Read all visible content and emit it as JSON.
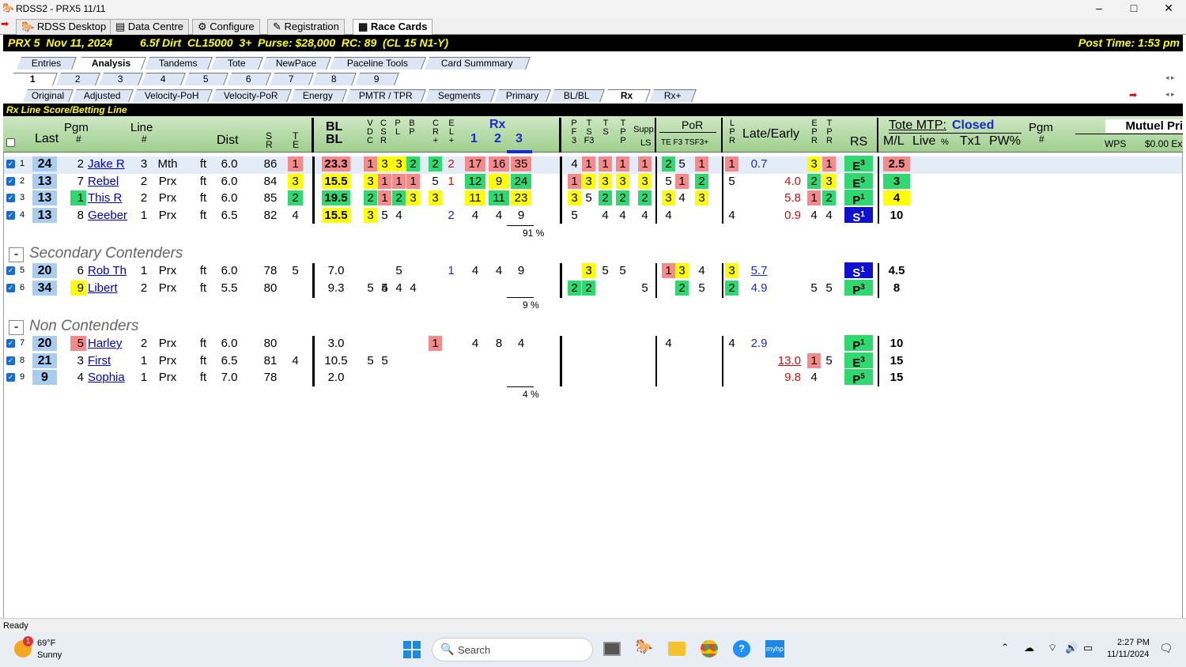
{
  "window": {
    "title": "RDSS2 - PRX5  11/11",
    "minimize": "–",
    "maximize": "□",
    "close": "✕"
  },
  "app_tabs": [
    "RDSS Desktop",
    "Data Centre",
    "Configure",
    "Registration",
    "Race Cards"
  ],
  "race": {
    "info": "PRX 5  Nov 11, 2024         6.5f Dirt  CL15000  3+  Purse: $28,000  RC: 89  (CL 15 N1-Y)",
    "post": "Post Time: 1:53 pm"
  },
  "view_tabs": [
    "Entries",
    "Analysis",
    "Tandems",
    "Tote",
    "NewPace",
    "Paceline Tools",
    "Card Summmary"
  ],
  "race_tabs": [
    "1",
    "2",
    "3",
    "4",
    "5",
    "6",
    "7",
    "8",
    "9"
  ],
  "sub_tabs": [
    "Original",
    "Adjusted",
    "Velocity-PoH",
    "Velocity-PoR",
    "Energy",
    "PMTR / TPR",
    "Segments",
    "Primary",
    "BL/BL",
    "Rx",
    "Rx+"
  ],
  "section_label": "Rx Line Score/Betting Line",
  "header": {
    "last": "Last",
    "pgm": "Pgm",
    "pgm_hash": "#",
    "line": "Line",
    "line_hash": "#",
    "dist": "Dist",
    "sr": "S\nR",
    "te": "T\nE",
    "blbl": "BL\nBL",
    "vdc": "V\nD\nC",
    "csr": "C\nS\nR",
    "pl": "P\nL",
    "bp": "B\nP",
    "cr": "C\nR\n+",
    "el": "E\nL\n+",
    "rx": "Rx",
    "rx1": "1",
    "rx2": "2",
    "rx3": "3",
    "pf3": "P\nF\n3",
    "tsf3": "T\nS\nF3",
    "ts": "T\nS",
    "tp": "T\nP\nP",
    "supp": "Supp.",
    "ls": "LS",
    "por": "PoR",
    "por_sub": "TE F3 TSF3+",
    "lpr": "L\nP\nR",
    "late": "Late/Early",
    "epr": "E\nP\nR",
    "tpr": "T\nP\nR",
    "rs": "RS",
    "tote": "Tote MTP:",
    "closed": "Closed",
    "ml": "M/L",
    "live": "Live",
    "pct": "%",
    "tx1": "Tx1",
    "pw": "PW%",
    "pgm2": "Pgm",
    "pgm2h": "#",
    "mutuel": "Mutuel Pri",
    "wps": "WPS",
    "ex": "$0.00 Ex"
  },
  "rows": [
    {
      "n": "1",
      "last": "24",
      "pgm": "2",
      "name": "Jake R",
      "line": "3",
      "trk": "Mth",
      "sf": "ft",
      "dist": "6.0",
      "sr": "86",
      "te": "1",
      "bl": "23.3",
      "vdc": "1",
      "csr": "3",
      "pl": "3",
      "bp": "2",
      "cr": "2",
      "el": "2",
      "r1": "17",
      "r2": "16",
      "r3": "35",
      "pf3": "4",
      "tsf3": "1",
      "ts": "1",
      "tp": "1",
      "supp": "1",
      "te2": "2",
      "f3": "5",
      "tsf": "1",
      "lpr": "1",
      "late": "0.7",
      "early": "",
      "epr": "3",
      "tpr": "1",
      "rs": "E",
      "rsn": "3",
      "ml": "2.5"
    },
    {
      "n": "2",
      "last": "13",
      "pgm": "7",
      "name": "Rebel",
      "line": "2",
      "trk": "Prx",
      "sf": "ft",
      "dist": "6.0",
      "sr": "84",
      "te": "3",
      "bl": "15.5",
      "vdc": "3",
      "csr": "1",
      "pl": "1",
      "bp": "1",
      "cr": "5",
      "el": "1",
      "r1": "12",
      "r2": "9",
      "r3": "24",
      "pf3": "1",
      "tsf3": "3",
      "ts": "3",
      "tp": "3",
      "supp": "3",
      "te2": "5",
      "f3": "1",
      "tsf": "2",
      "lpr": "5",
      "late": "",
      "early": "4.0",
      "epr": "2",
      "tpr": "3",
      "rs": "E",
      "rsn": "5",
      "ml": "3"
    },
    {
      "n": "3",
      "last": "13",
      "pgm": "1",
      "name": "This R",
      "line": "2",
      "trk": "Prx",
      "sf": "ft",
      "dist": "6.0",
      "sr": "85",
      "te": "2",
      "bl": "19.5",
      "vdc": "2",
      "csr": "1",
      "pl": "2",
      "bp": "3",
      "cr": "3",
      "el": "",
      "r1": "11",
      "r2": "11",
      "r3": "23",
      "pf3": "3",
      "tsf3": "5",
      "ts": "2",
      "tp": "2",
      "supp": "2",
      "te2": "3",
      "f3": "4",
      "tsf": "3",
      "lpr": "",
      "late": "",
      "early": "5.8",
      "epr": "1",
      "tpr": "2",
      "rs": "P",
      "rsn": "1",
      "ml": "4"
    },
    {
      "n": "4",
      "last": "13",
      "pgm": "8",
      "name": "Geeber",
      "line": "1",
      "trk": "Prx",
      "sf": "ft",
      "dist": "6.5",
      "sr": "82",
      "te": "4",
      "bl": "15.5",
      "vdc": "3",
      "csr": "5",
      "pl": "4",
      "bp": "",
      "cr": "",
      "el": "2",
      "r1": "4",
      "r2": "4",
      "r3": "9",
      "pf3": "5",
      "tsf3": "",
      "ts": "4",
      "tp": "4",
      "supp": "4",
      "te2": "4",
      "f3": "",
      "tsf": "",
      "lpr": "4",
      "late": "",
      "early": "0.9",
      "epr": "4",
      "tpr": "4",
      "rs": "S",
      "rsn": "1",
      "ml": "10"
    }
  ],
  "pct1": "91 %",
  "secondary_title": "Secondary Contenders",
  "rows2": [
    {
      "n": "5",
      "last": "20",
      "pgm": "6",
      "name": "Rob Th",
      "line": "1",
      "trk": "Prx",
      "sf": "ft",
      "dist": "6.0",
      "sr": "78",
      "te": "5",
      "bl": "7.0",
      "pl": "5",
      "el": "1",
      "r1": "4",
      "r2": "4",
      "r3": "9",
      "tsf3": "3",
      "ts": "5",
      "tp": "5",
      "te2": "1",
      "f3": "3",
      "tsf": "4",
      "lpr": "3",
      "late": "5.7",
      "rs": "S",
      "rsn": "1",
      "ml": "4.5"
    },
    {
      "n": "6",
      "last": "34",
      "pgm": "9",
      "name": "Libert",
      "line": "2",
      "trk": "Prx",
      "sf": "ft",
      "dist": "5.5",
      "sr": "80",
      "te": "",
      "bl": "9.3",
      "vdc": "5",
      "csr": "4",
      "pl2": "5",
      "pl": "4",
      "bp": "4",
      "pf3": "2",
      "tsf3": "2",
      "supp": "5",
      "f3": "2",
      "tsf": "5",
      "lpr": "2",
      "late": "4.9",
      "epr": "5",
      "tpr": "5",
      "rs": "P",
      "rsn": "3",
      "ml": "8"
    }
  ],
  "pct2": "9 %",
  "non_title": "Non Contenders",
  "rows3": [
    {
      "n": "7",
      "last": "20",
      "pgm": "5",
      "name": "Harley",
      "line": "2",
      "trk": "Prx",
      "sf": "ft",
      "dist": "6.0",
      "sr": "80",
      "te": "",
      "bl": "3.0",
      "cr": "1",
      "r1": "4",
      "r2": "8",
      "r3": "4",
      "te2": "4",
      "lpr": "4",
      "late": "2.9",
      "rs": "P",
      "rsn": "1",
      "ml": "10"
    },
    {
      "n": "8",
      "last": "21",
      "pgm": "3",
      "name": "First",
      "line": "1",
      "trk": "Prx",
      "sf": "ft",
      "dist": "6.5",
      "sr": "81",
      "te": "4",
      "bl": "10.5",
      "vdc": "5",
      "csr": "5",
      "early": "13.0",
      "epr": "1",
      "tpr": "5",
      "rs": "E",
      "rsn": "3",
      "ml": "15"
    },
    {
      "n": "9",
      "last": "9",
      "pgm": "4",
      "name": "Sophia",
      "line": "1",
      "trk": "Prx",
      "sf": "ft",
      "dist": "7.0",
      "sr": "78",
      "te": "",
      "bl": "2.0",
      "early": "9.8",
      "epr": "4",
      "rs": "P",
      "rsn": "5",
      "ml": "15"
    }
  ],
  "pct3": "4 %",
  "status": "Ready",
  "taskbar": {
    "temp": "69°F",
    "weather": "Sunny",
    "badge": "1",
    "search": "Search",
    "time": "2:27 PM",
    "date": "11/11/2024"
  }
}
